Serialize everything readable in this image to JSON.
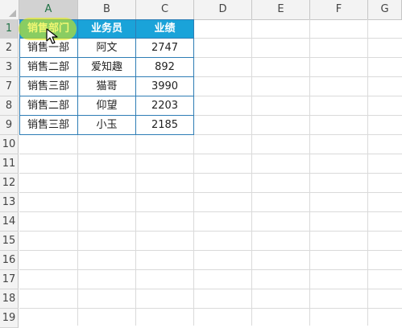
{
  "columns": [
    "A",
    "B",
    "C",
    "D",
    "E",
    "F",
    "G"
  ],
  "rows": [
    "1",
    "2",
    "3",
    "7",
    "8",
    "9",
    "10",
    "11",
    "12",
    "13",
    "14",
    "15",
    "16",
    "17",
    "18",
    "19"
  ],
  "table": {
    "headers": [
      "销售部门",
      "业务员",
      "业绩"
    ],
    "rows": [
      [
        "销售一部",
        "阿文",
        "2747"
      ],
      [
        "销售二部",
        "爱知趣",
        "892"
      ],
      [
        "销售三部",
        "猫哥",
        "3990"
      ],
      [
        "销售二部",
        "仰望",
        "2203"
      ],
      [
        "销售三部",
        "小玉",
        "2185"
      ]
    ]
  },
  "colors": {
    "header_fill": "#1aa3d9",
    "header_text": "#ffffff",
    "table_border": "#2e7db5",
    "cursor_highlight": "#e6f000"
  }
}
